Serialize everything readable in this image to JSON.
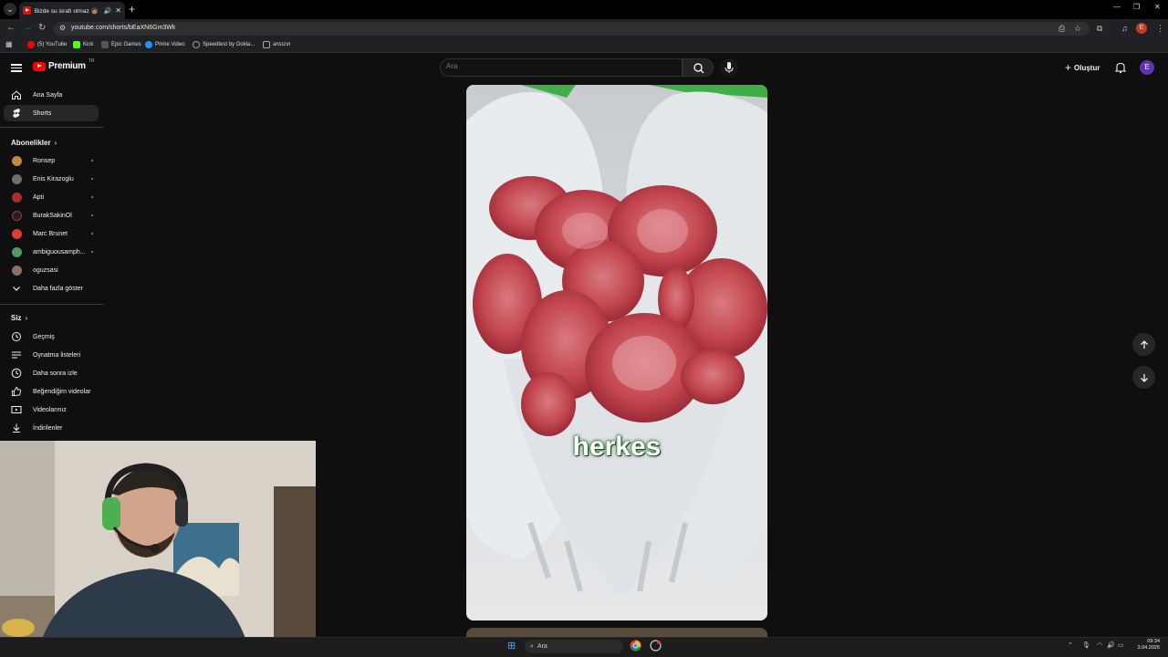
{
  "browser": {
    "tab_title": "Bizde su israfı olmaz 🧑🏽 - Y",
    "url": "youtube.com/shorts/bEaXN6Gm3Wk",
    "bookmarks": [
      {
        "label": "(5) YouTube",
        "color": "#ff0000"
      },
      {
        "label": "Kick",
        "color": "#53fc18"
      },
      {
        "label": "Epic Games",
        "color": "#555555"
      },
      {
        "label": "Prime Video",
        "color": "#1a98ff"
      },
      {
        "label": "Speedtest by Ookla...",
        "color": "#666666"
      },
      {
        "label": "ansızın",
        "color": "#888888"
      }
    ],
    "profile_initial": "E"
  },
  "youtube": {
    "brand": "Premium",
    "region": "TR",
    "search_placeholder": "Ara",
    "create_label": "Oluştur",
    "avatar_initial": "E",
    "accent": "#ff0000"
  },
  "sidebar": {
    "main": [
      {
        "label": "Ana Sayfa",
        "icon": "home-icon"
      },
      {
        "label": "Shorts",
        "icon": "shorts-icon",
        "active": true
      }
    ],
    "subscriptions_title": "Abonelikler",
    "subscriptions": [
      {
        "label": "Ronsep",
        "color": "#c08a3e"
      },
      {
        "label": "Enis Kirazoglu",
        "color": "#6d6d6d"
      },
      {
        "label": "Apti",
        "color": "#b02b2b"
      },
      {
        "label": "BurakSakinOl",
        "color": "#222222"
      },
      {
        "label": "Marc Brunet",
        "color": "#e53935"
      },
      {
        "label": "ambiguousamph...",
        "color": "#4f9a5f"
      },
      {
        "label": "oguzsasi",
        "color": "#8d6e63"
      }
    ],
    "show_more": "Daha fazla göster",
    "you_title": "Siz",
    "you_items": [
      {
        "label": "Geçmiş",
        "icon": "history-icon"
      },
      {
        "label": "Oynatma listeleri",
        "icon": "playlists-icon"
      },
      {
        "label": "Daha sonra izle",
        "icon": "watch-later-icon"
      },
      {
        "label": "Beğendiğim videolar",
        "icon": "liked-videos-icon"
      },
      {
        "label": "Videolarınız",
        "icon": "your-videos-icon"
      },
      {
        "label": "İndirilenler",
        "icon": "downloads-icon"
      }
    ]
  },
  "short": {
    "caption": "herkes"
  },
  "taskbar": {
    "search_label": "Ara",
    "time": "09:34",
    "date": "3.04.2026"
  }
}
